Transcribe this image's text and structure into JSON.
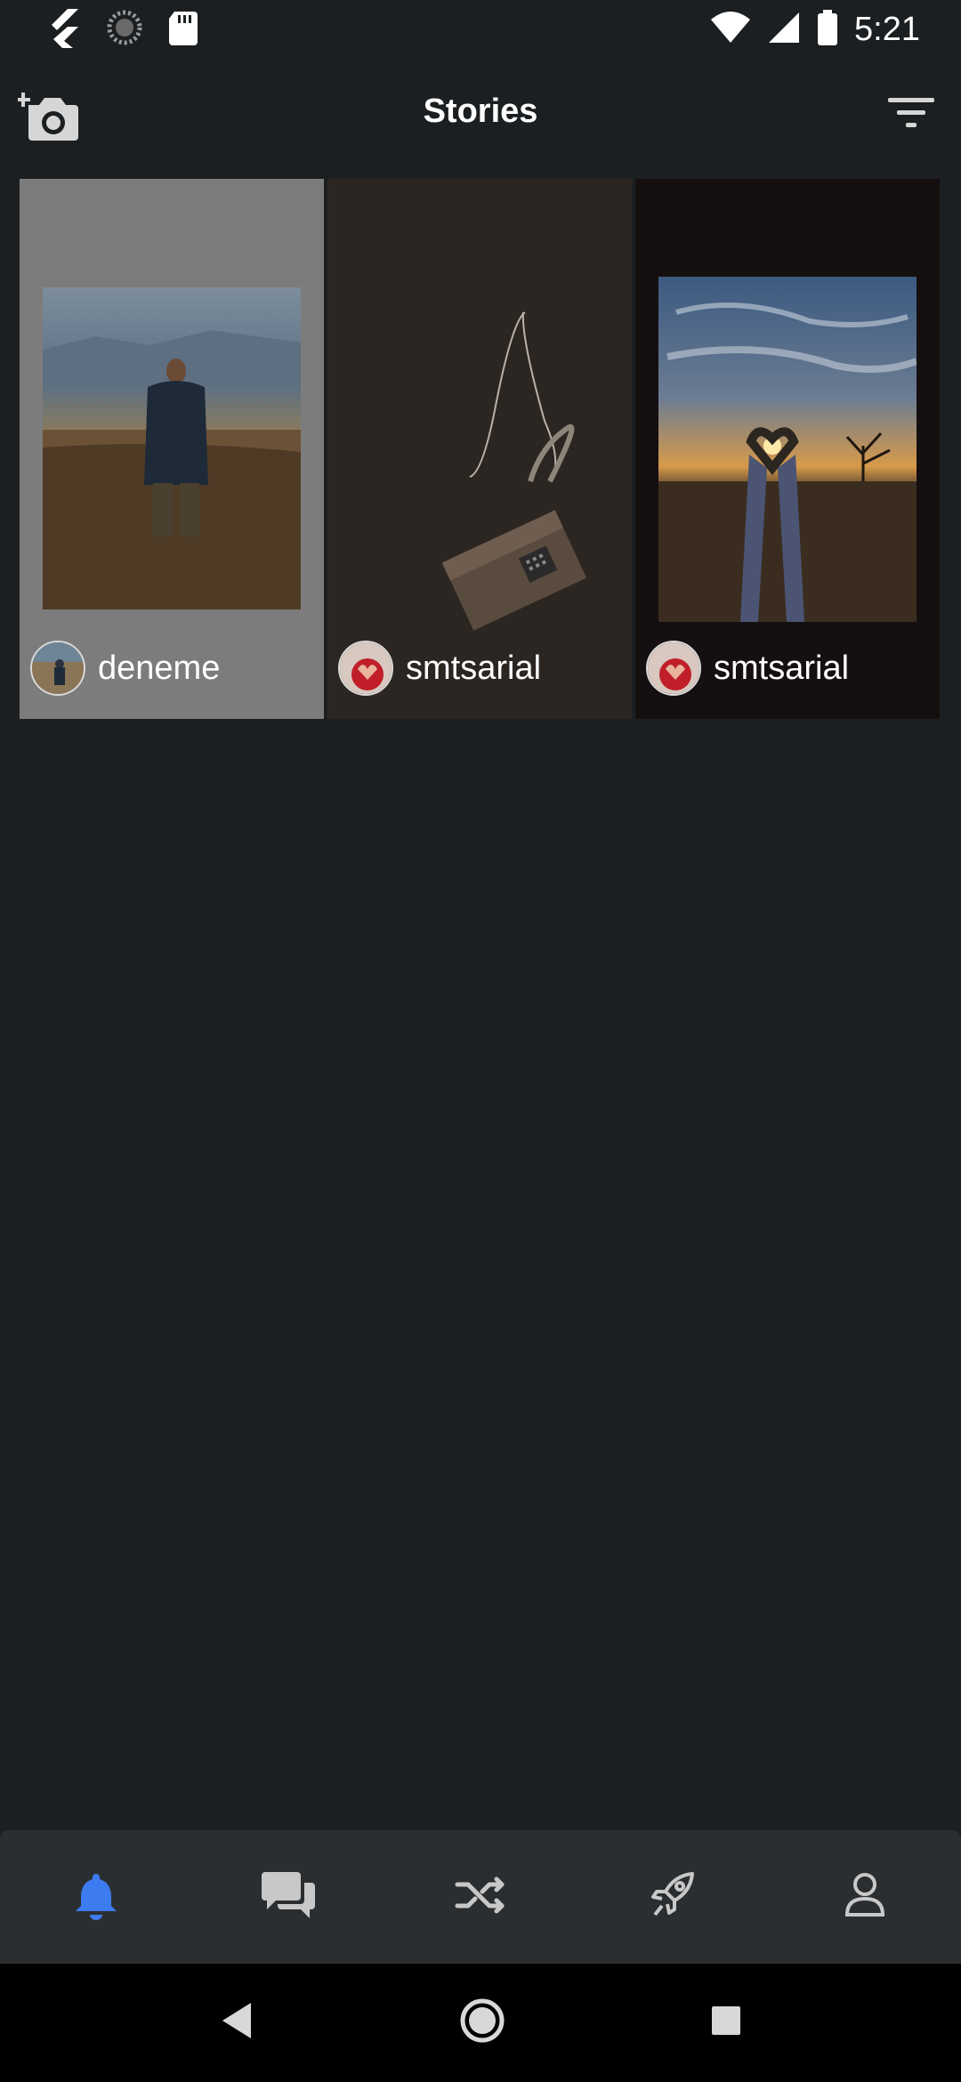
{
  "status_bar": {
    "time": "5:21",
    "icons": [
      "flutter-icon",
      "loading-icon",
      "sd-card-icon",
      "wifi-icon",
      "signal-icon",
      "battery-icon"
    ]
  },
  "app_bar": {
    "title": "Stories",
    "left_icon": "add-photo-icon",
    "right_icon": "filter-icon"
  },
  "stories": [
    {
      "author": "deneme",
      "photo": "man-in-field"
    },
    {
      "author": "smtsarial",
      "photo": "telephone-handset"
    },
    {
      "author": "smtsarial",
      "photo": "heart-hands-sunset"
    }
  ],
  "bottom_nav": {
    "items": [
      {
        "icon": "bell-icon",
        "active": true
      },
      {
        "icon": "chat-icon",
        "active": false
      },
      {
        "icon": "shuffle-icon",
        "active": false
      },
      {
        "icon": "rocket-icon",
        "active": false
      },
      {
        "icon": "profile-icon",
        "active": false
      }
    ],
    "active_color": "#3d7bf0",
    "inactive_color": "#c8c8c8"
  },
  "colors": {
    "background": "#1c1f21",
    "nav_background": "#2b2e31"
  }
}
